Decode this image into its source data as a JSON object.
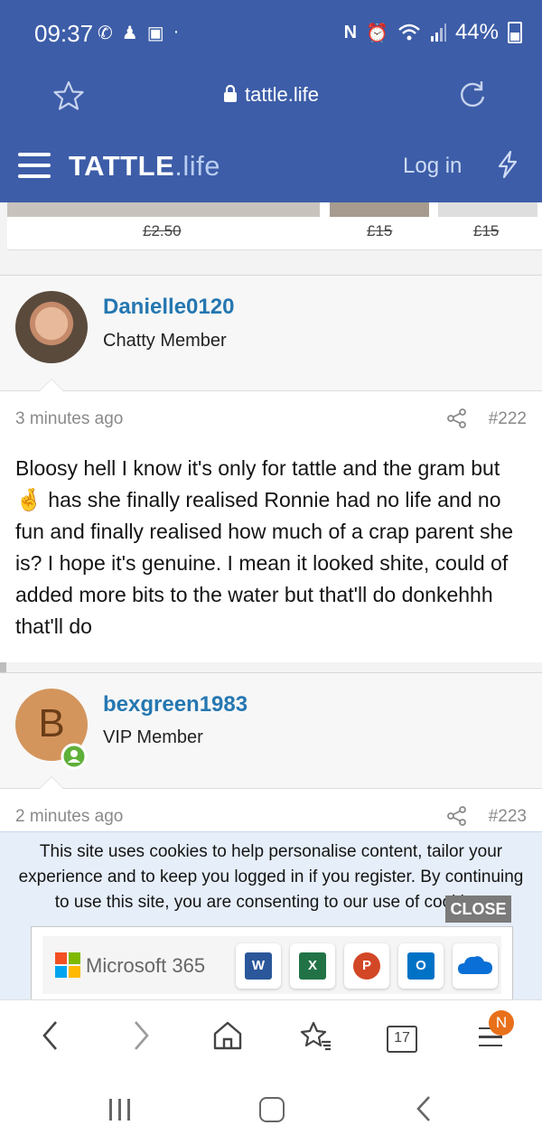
{
  "status_bar": {
    "time": "09:37",
    "battery": "44%"
  },
  "url_bar": {
    "domain": "tattle.life"
  },
  "site_header": {
    "logo_main": "TATTLE",
    "logo_suffix": ".life",
    "login": "Log in"
  },
  "ad_strip": {
    "prices": [
      "£2.50",
      "£15",
      "£15"
    ]
  },
  "posts": [
    {
      "username": "Danielle0120",
      "user_title": "Chatty Member",
      "time": "3 minutes ago",
      "post_number": "#222",
      "message_before_emoji": "Bloosy hell I know it's only for tattle and the gram but",
      "emoji": "🤞",
      "message_after_emoji": "has she finally realised Ronnie had no life and no fun and finally realised how much of a crap parent she is? I hope it's genuine. I mean it looked shite, could of added more bits to the water but that'll do donkehhh that'll do"
    },
    {
      "username": "bexgreen1983",
      "avatar_letter": "B",
      "user_title": "VIP Member",
      "time": "2 minutes ago",
      "post_number": "#223"
    }
  ],
  "cookie_banner": {
    "text": "This site uses cookies to help personalise content, tailor your experience and to keep you logged in if you register. By continuing to use this site, you are consenting to our use of cookies.",
    "close_label": "CLOSE"
  },
  "ms365_ad": {
    "title": "Microsoft 365",
    "apps": [
      "Word",
      "Excel",
      "PowerPoint",
      "Outlook",
      "OneDrive"
    ]
  },
  "browser_nav": {
    "tabs_count": "17",
    "menu_badge": "N"
  },
  "colors": {
    "brand_blue": "#3d5da8",
    "username_blue": "#2577b1",
    "online_green": "#5fb03a",
    "badge_orange": "#e8701a"
  }
}
